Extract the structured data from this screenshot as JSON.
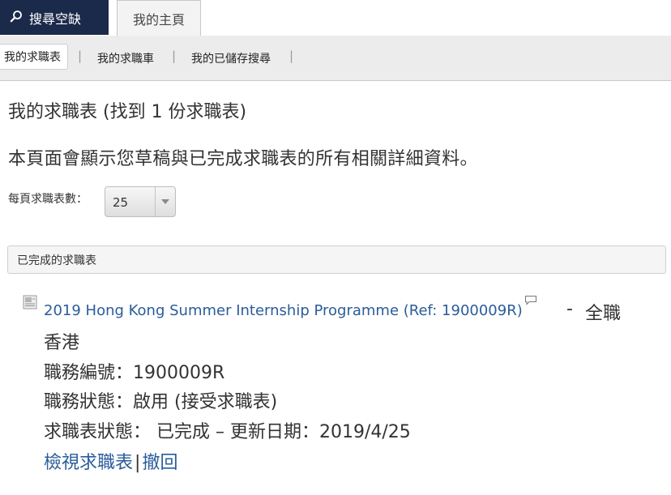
{
  "tabs": {
    "search_label": "搜尋空缺",
    "home_label": "我的主頁"
  },
  "subnav": {
    "active_label": "我的求職表",
    "items": [
      "我的求職車",
      "我的已儲存搜尋"
    ],
    "separator": "|"
  },
  "page": {
    "title": "我的求職表 (找到 1 份求職表)",
    "description": "本頁面會顯示您草稿與已完成求職表的所有相關詳細資料。",
    "per_page_label": "每頁求職表數：",
    "per_page_value": "25"
  },
  "section": {
    "title": "已完成的求職表"
  },
  "application": {
    "job_title": "2019 Hong Kong Summer Internship Programme (Ref: 1900009R)",
    "dash": "-",
    "job_type": "全職",
    "location": "香港",
    "job_number": "職務編號：1900009R",
    "job_status": "職務狀態：啟用 (接受求職表)",
    "application_status": "求職表狀態： 已完成 – 更新日期：2019/4/25",
    "view_label": "檢視求職表",
    "action_separator": "|",
    "withdraw_label": "撤回"
  },
  "icons": {
    "search_tab": "search-icon",
    "dropdown": "chevron-down-icon",
    "document": "document-icon",
    "comment": "comment-icon"
  },
  "colors": {
    "nav_dark": "#1b2a4a",
    "link": "#2a5c9a"
  }
}
